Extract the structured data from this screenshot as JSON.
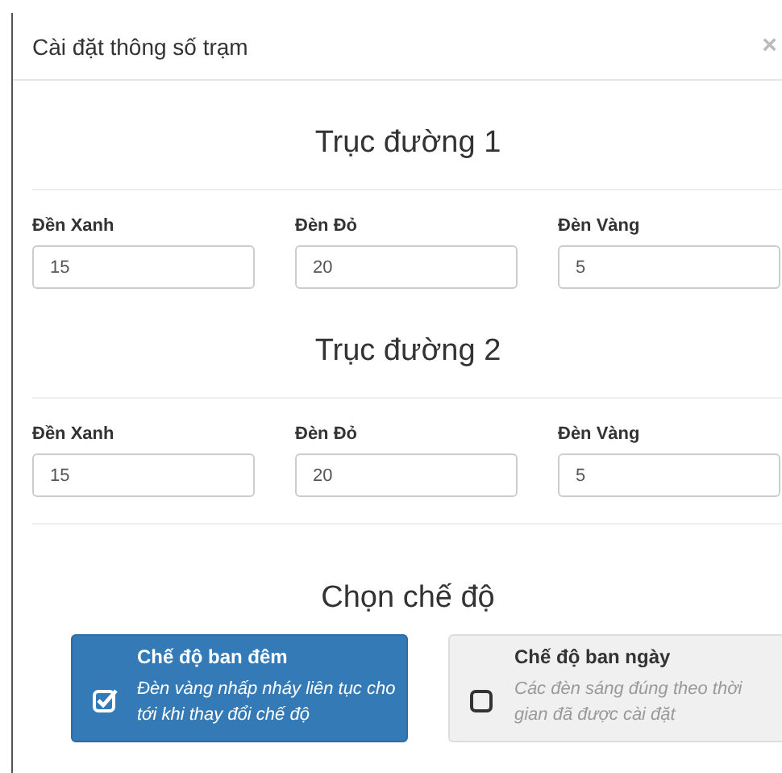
{
  "dialog": {
    "title": "Cài đặt thông số trạm",
    "close": "×"
  },
  "sections": [
    {
      "title": "Trục đường 1",
      "fields": [
        {
          "label": "Đền Xanh",
          "value": "15"
        },
        {
          "label": "Đèn Đỏ",
          "value": "20"
        },
        {
          "label": "Đèn Vàng",
          "value": "5"
        }
      ]
    },
    {
      "title": "Trục đường 2",
      "fields": [
        {
          "label": "Đền Xanh",
          "value": "15"
        },
        {
          "label": "Đèn Đỏ",
          "value": "20"
        },
        {
          "label": "Đèn Vàng",
          "value": "5"
        }
      ]
    }
  ],
  "mode": {
    "title": "Chọn chế độ",
    "options": [
      {
        "title": "Chế độ ban đêm",
        "description": "Đèn vàng nhấp nháy liên tục cho tới khi thay đổi chế độ",
        "selected": true
      },
      {
        "title": "Chế độ ban ngày",
        "description": "Các đèn sáng đúng theo thời gian đã được cài đặt",
        "selected": false
      }
    ]
  }
}
